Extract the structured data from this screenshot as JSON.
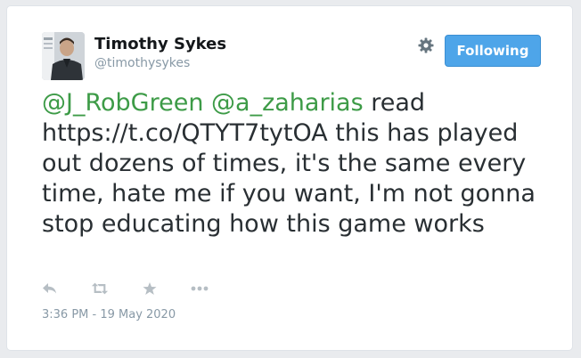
{
  "tweet": {
    "author": {
      "name": "Timothy Sykes",
      "handle": "@timothysykes",
      "avatar_icon": "profile-photo"
    },
    "follow_button_label": "Following",
    "settings_icon": "gear-icon",
    "mentions": [
      "@J_RobGreen",
      "@a_zaharias"
    ],
    "body_text": "read https://t.co/QTYT7tytOA this has played out dozens of times, it's the same every time, hate me if you want, I'm not gonna stop educating how this game works",
    "actions": [
      "reply-icon",
      "retweet-icon",
      "favorite-icon",
      "more-icon"
    ],
    "timestamp": "3:36 PM - 19 May 2020"
  },
  "colors": {
    "mention": "#3d9b47",
    "button": "#4ea5e9",
    "text": "#292f33",
    "muted": "#8899a6"
  }
}
